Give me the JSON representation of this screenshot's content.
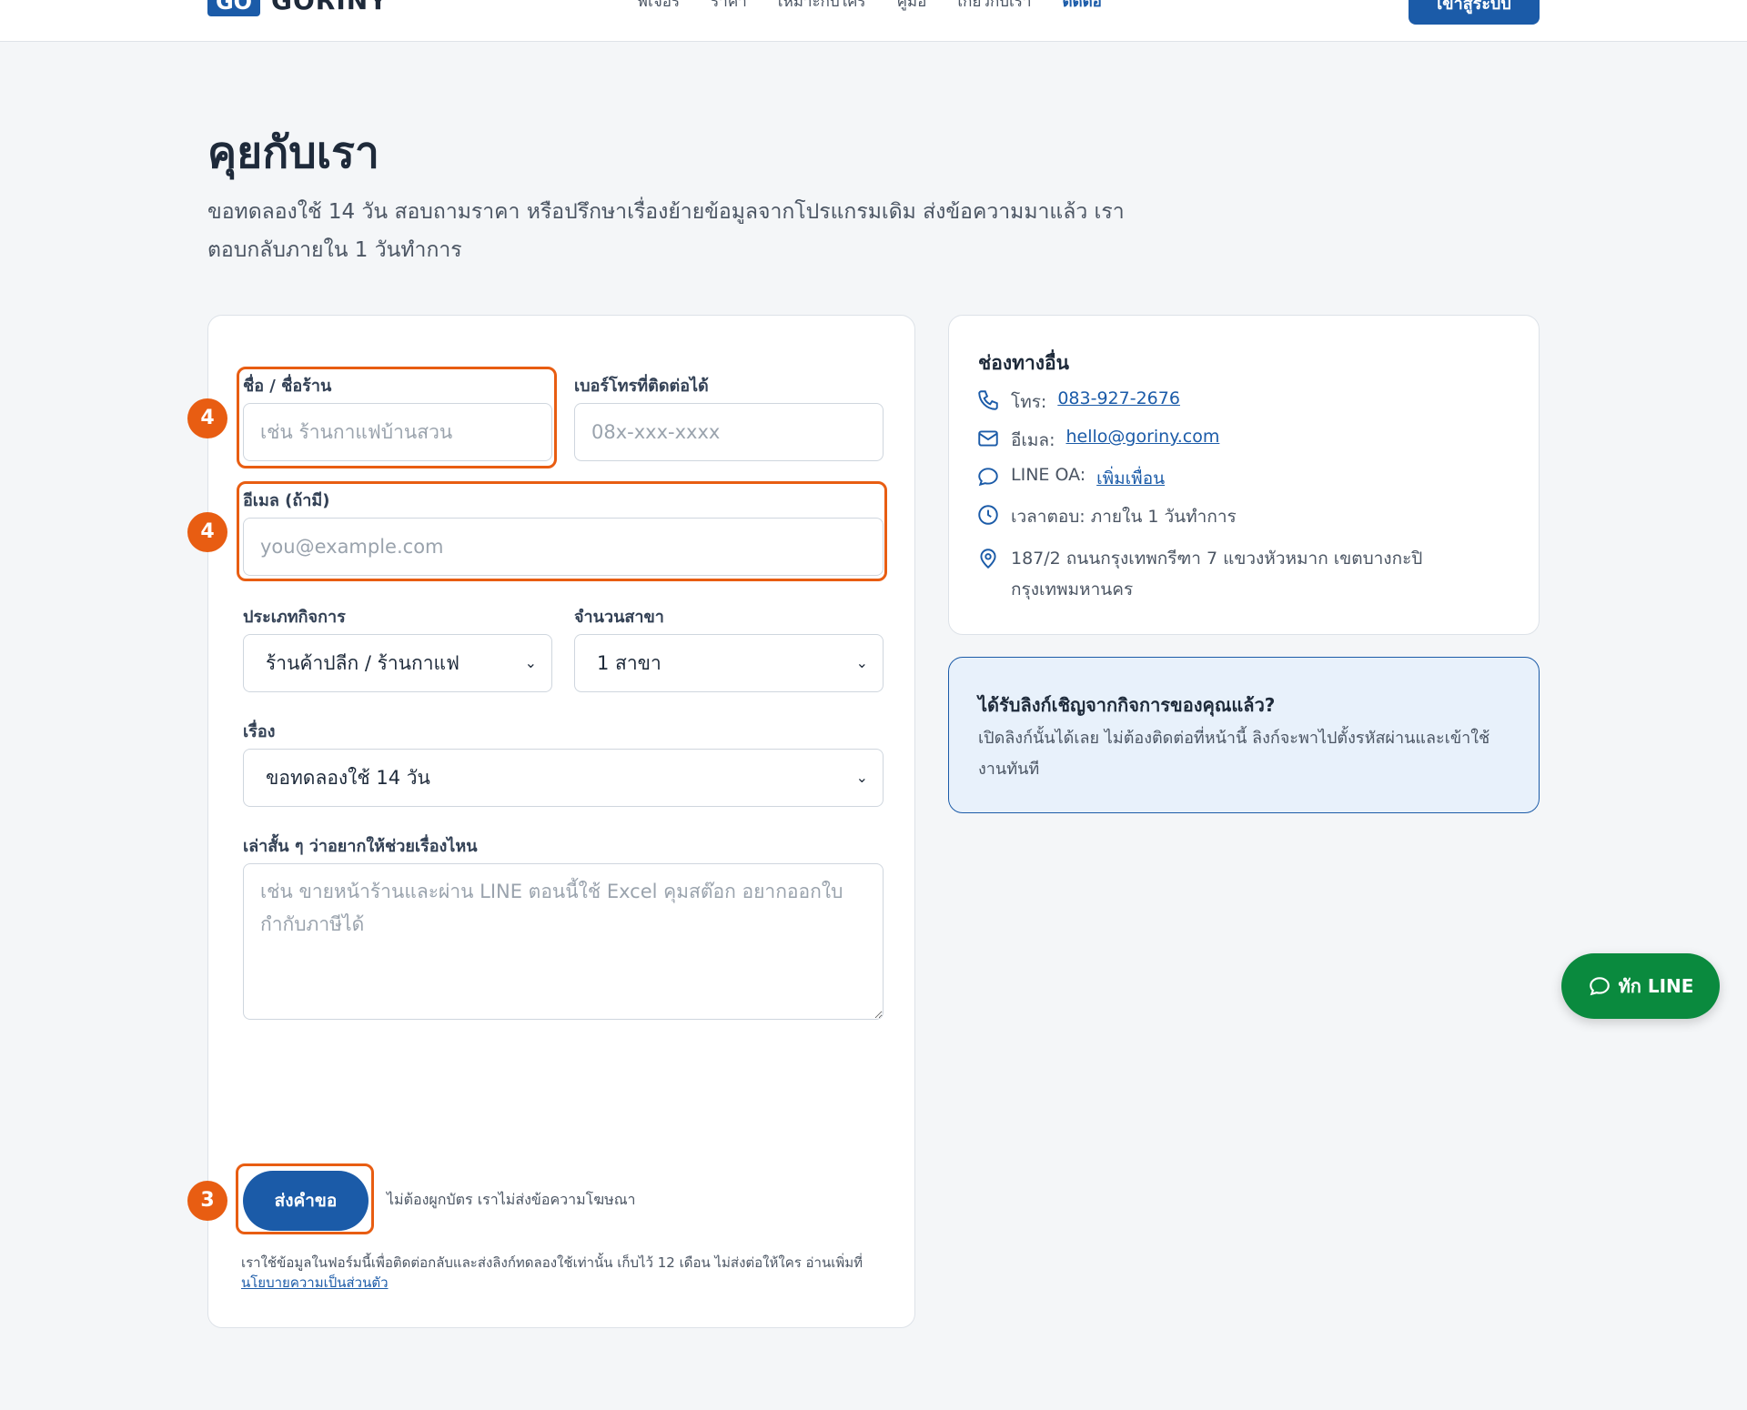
{
  "header": {
    "logo_mark": "GO",
    "logo_text": "GORINY",
    "nav": [
      "ฟีเจอร์",
      "ราคา",
      "เหมาะกับใคร",
      "คู่มือ",
      "เกี่ยวกับเรา",
      "ติดต่อ"
    ],
    "active_nav": "ติดต่อ",
    "login_label": "เข้าสู่ระบบ"
  },
  "page": {
    "title": "คุยกับเรา",
    "subtitle": "ขอทดลองใช้ 14 วัน สอบถามราคา หรือปรึกษาเรื่องย้ายข้อมูลจากโปรแกรมเดิม ส่งข้อความมาแล้ว เราตอบกลับภายใน 1 วันทำการ"
  },
  "form": {
    "name_label": "ชื่อ / ชื่อร้าน",
    "name_placeholder": "เช่น ร้านกาแฟบ้านสวน",
    "phone_label": "เบอร์โทรที่ติดต่อได้",
    "phone_placeholder": "08x-xxx-xxxx",
    "email_label": "อีเมล (ถ้ามี)",
    "email_placeholder": "you@example.com",
    "business_type_label": "ประเภทกิจการ",
    "business_type_value": "ร้านค้าปลีก / ร้านกาแฟ",
    "branches_label": "จำนวนสาขา",
    "branches_value": "1 สาขา",
    "topic_label": "เรื่อง",
    "topic_value": "ขอทดลองใช้ 14 วัน",
    "message_label": "เล่าสั้น ๆ ว่าอยากให้ช่วยเรื่องไหน",
    "message_placeholder": "เช่น ขายหน้าร้านและผ่าน LINE ตอนนี้ใช้ Excel คุมสต๊อก อยากออกใบกำกับภาษีได้",
    "submit_label": "ส่งคำขอ",
    "submit_note": "ไม่ต้องผูกบัตร เราไม่ส่งข้อความโฆษณา",
    "privacy_text": "เราใช้ข้อมูลในฟอร์มนี้เพื่อติดต่อกลับและส่งลิงก์ทดลองใช้เท่านั้น เก็บไว้ 12 เดือน ไม่ส่งต่อให้ใคร อ่านเพิ่มที่",
    "privacy_link": "นโยบายความเป็นส่วนตัว"
  },
  "annotations": {
    "badge_name": "4",
    "badge_email": "4",
    "badge_submit": "3",
    "highlight_color": "#e85d12"
  },
  "contact": {
    "title": "ช่องทางอื่น",
    "phone_label": "โทร:",
    "phone_value": "083-927-2676",
    "email_label": "อีเมล:",
    "email_value": "hello@goriny.com",
    "line_label": "LINE OA:",
    "line_value": "เพิ่มเพื่อน",
    "hours": "เวลาตอบ: ภายใน 1 วันทำการ",
    "address": "187/2 ถนนกรุงเทพกรีฑา 7 แขวงหัวหมาก เขตบางกะปิ กรุงเทพมหานคร"
  },
  "invite": {
    "title": "ได้รับลิงก์เชิญจากกิจการของคุณแล้ว?",
    "text": "เปิดลิงก์นั้นได้เลย ไม่ต้องติดต่อที่หน้านี้ ลิงก์จะพาไปตั้งรหัสผ่านและเข้าใช้งานทันที"
  },
  "floating": {
    "line_label": "ทัก LINE"
  },
  "colors": {
    "primary": "#1b5ba8",
    "line_green": "#0a8a3e",
    "highlight": "#e85d12"
  }
}
